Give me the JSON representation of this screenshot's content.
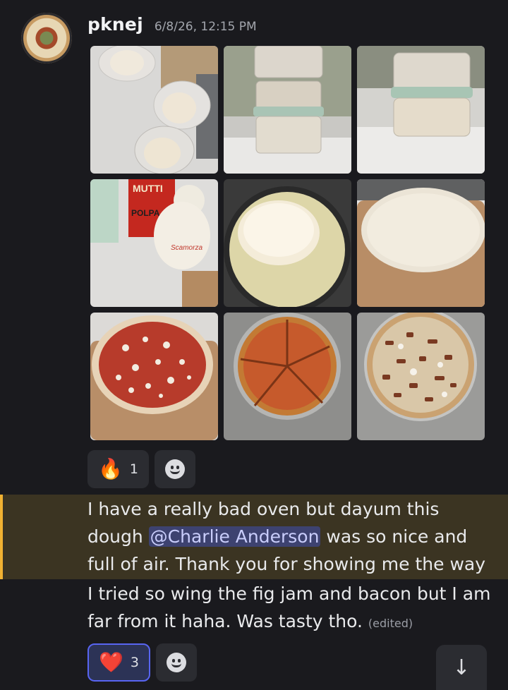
{
  "message": {
    "author": "pknej",
    "timestamp": "6/8/26, 12:15 PM",
    "attachments_count": 9
  },
  "reactions1": [
    {
      "emoji": "🔥",
      "count": "1",
      "icon": "fire-emoji"
    }
  ],
  "text1": {
    "before_mention": "I have a really bad oven but dayum this dough ",
    "mention": "@Charlie Anderson",
    "after_mention": " was so nice and full of air. Thank you for showing me the way"
  },
  "text2": {
    "body": "I tried so wing the fig jam and bacon but I am far from it haha. Was tasty tho.",
    "edited": "(edited)"
  },
  "reactions2": [
    {
      "emoji": "❤️",
      "count": "3",
      "icon": "heart-emoji"
    }
  ],
  "jump_icon": "arrow-down-icon",
  "colors": {
    "background": "#1a1a1e",
    "highlight_bg": "#3b3422",
    "highlight_bar": "#f0b132",
    "mention_bg": "#3d4270",
    "reaction_active_border": "#5865f2"
  },
  "photo_labels": {
    "can_brand": "MUTTI",
    "can_label": "POLPA",
    "cheese_label": "Scamorza"
  }
}
